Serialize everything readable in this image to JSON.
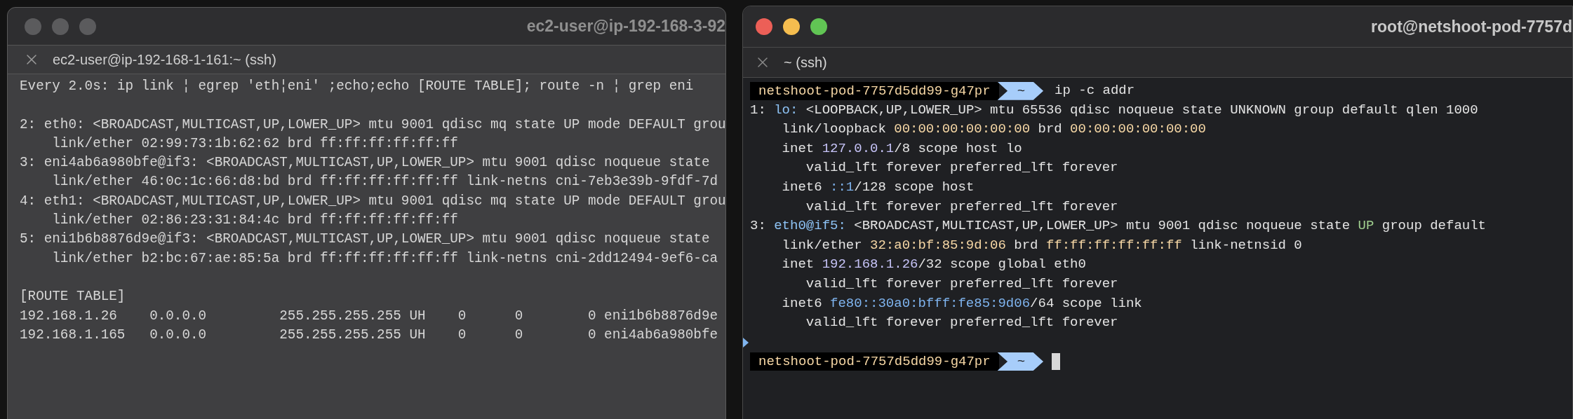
{
  "left_window": {
    "title": "ec2-user@ip-192-168-3-92",
    "tab": {
      "label": "ec2-user@ip-192-168-1-161:~ (ssh)"
    },
    "lines": [
      {
        "kind": "text",
        "text": "Every 2.0s: ip link ¦ egrep 'eth¦eni' ;echo;echo [ROUTE TABLE]; route -n ¦ grep eni"
      },
      {
        "kind": "blank"
      },
      {
        "kind": "text",
        "text": "2: eth0: <BROADCAST,MULTICAST,UP,LOWER_UP> mtu 9001 qdisc mq state UP mode DEFAULT grou"
      },
      {
        "kind": "text",
        "text": "    link/ether 02:99:73:1b:62:62 brd ff:ff:ff:ff:ff:ff"
      },
      {
        "kind": "text",
        "text": "3: eni4ab6a980bfe@if3: <BROADCAST,MULTICAST,UP,LOWER_UP> mtu 9001 qdisc noqueue state"
      },
      {
        "kind": "text",
        "text": "    link/ether 46:0c:1c:66:d8:bd brd ff:ff:ff:ff:ff:ff link-netns cni-7eb3e39b-9fdf-7d"
      },
      {
        "kind": "text",
        "text": "4: eth1: <BROADCAST,MULTICAST,UP,LOWER_UP> mtu 9001 qdisc mq state UP mode DEFAULT grou"
      },
      {
        "kind": "text",
        "text": "    link/ether 02:86:23:31:84:4c brd ff:ff:ff:ff:ff:ff"
      },
      {
        "kind": "text",
        "text": "5: eni1b6b8876d9e@if3: <BROADCAST,MULTICAST,UP,LOWER_UP> mtu 9001 qdisc noqueue state"
      },
      {
        "kind": "text",
        "text": "    link/ether b2:bc:67:ae:85:5a brd ff:ff:ff:ff:ff:ff link-netns cni-2dd12494-9ef6-ca"
      },
      {
        "kind": "blank"
      },
      {
        "kind": "text",
        "text": "[ROUTE TABLE]"
      },
      {
        "kind": "text",
        "text": "192.168.1.26    0.0.0.0         255.255.255.255 UH    0      0        0 eni1b6b8876d9e"
      },
      {
        "kind": "text",
        "text": "192.168.1.165   0.0.0.0         255.255.255.255 UH    0      0        0 eni4ab6a980bfe"
      }
    ]
  },
  "right_window": {
    "title": "root@netshoot-pod-7757d",
    "tab": {
      "label": "~ (ssh)"
    },
    "lines": [
      {
        "kind": "prompt",
        "host": "netshoot-pod-7757d5dd99-g47pr",
        "dir": "~",
        "command": "ip -c addr",
        "cursor": false
      },
      {
        "kind": "output",
        "segments": [
          {
            "kind": "plain",
            "text": "1: "
          },
          {
            "kind": "iface",
            "text": "lo:"
          },
          {
            "kind": "plain",
            "text": " <LOOPBACK,UP,LOWER_UP> mtu 65536 qdisc noqueue state UNKNOWN group default qlen 1000"
          }
        ]
      },
      {
        "kind": "output",
        "segments": [
          {
            "kind": "plain",
            "text": "    link/loopback "
          },
          {
            "kind": "mac",
            "text": "00:00:00:00:00:00"
          },
          {
            "kind": "plain",
            "text": " brd "
          },
          {
            "kind": "mac",
            "text": "00:00:00:00:00:00"
          }
        ]
      },
      {
        "kind": "output",
        "segments": [
          {
            "kind": "plain",
            "text": "    inet "
          },
          {
            "kind": "ipv4",
            "text": "127.0.0.1"
          },
          {
            "kind": "plain",
            "text": "/8 scope host lo"
          }
        ]
      },
      {
        "kind": "output",
        "segments": [
          {
            "kind": "plain",
            "text": "       valid_lft forever preferred_lft forever"
          }
        ]
      },
      {
        "kind": "output",
        "segments": [
          {
            "kind": "plain",
            "text": "    inet6 "
          },
          {
            "kind": "ipv6",
            "text": "::1"
          },
          {
            "kind": "plain",
            "text": "/128 scope host"
          }
        ]
      },
      {
        "kind": "output",
        "segments": [
          {
            "kind": "plain",
            "text": "       valid_lft forever preferred_lft forever"
          }
        ]
      },
      {
        "kind": "output",
        "segments": [
          {
            "kind": "plain",
            "text": "3: "
          },
          {
            "kind": "iface",
            "text": "eth0@if5:"
          },
          {
            "kind": "plain",
            "text": " <BROADCAST,MULTICAST,UP,LOWER_UP> mtu 9001 qdisc noqueue state "
          },
          {
            "kind": "state",
            "text": "UP"
          },
          {
            "kind": "plain",
            "text": " group default"
          }
        ]
      },
      {
        "kind": "output",
        "segments": [
          {
            "kind": "plain",
            "text": "    link/ether "
          },
          {
            "kind": "mac",
            "text": "32:a0:bf:85:9d:06"
          },
          {
            "kind": "plain",
            "text": " brd "
          },
          {
            "kind": "mac",
            "text": "ff:ff:ff:ff:ff:ff"
          },
          {
            "kind": "plain",
            "text": " link-netnsid 0"
          }
        ]
      },
      {
        "kind": "output",
        "segments": [
          {
            "kind": "plain",
            "text": "    inet "
          },
          {
            "kind": "ipv4",
            "text": "192.168.1.26"
          },
          {
            "kind": "plain",
            "text": "/32 scope global eth0"
          }
        ]
      },
      {
        "kind": "output",
        "segments": [
          {
            "kind": "plain",
            "text": "       valid_lft forever preferred_lft forever"
          }
        ]
      },
      {
        "kind": "output",
        "segments": [
          {
            "kind": "plain",
            "text": "    inet6 "
          },
          {
            "kind": "ipv6",
            "text": "fe80::30a0:bfff:fe85:9d06"
          },
          {
            "kind": "plain",
            "text": "/64 scope link"
          }
        ]
      },
      {
        "kind": "output",
        "segments": [
          {
            "kind": "plain",
            "text": "       valid_lft forever preferred_lft forever"
          }
        ]
      },
      {
        "kind": "blank",
        "marked": true
      },
      {
        "kind": "prompt",
        "host": "netshoot-pod-7757d5dd99-g47pr",
        "dir": "~",
        "cursor": true
      }
    ]
  }
}
